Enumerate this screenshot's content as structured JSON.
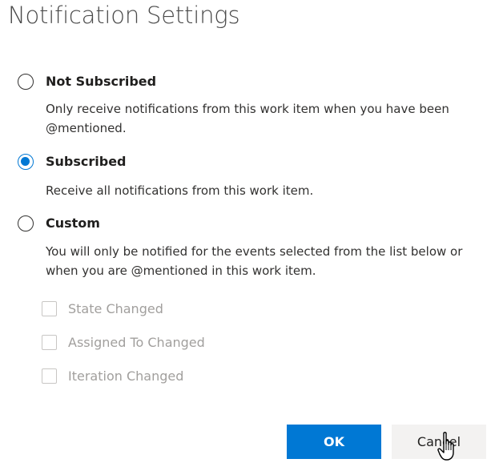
{
  "dialog": {
    "title": "Notification Settings"
  },
  "options": [
    {
      "label": "Not Subscribed",
      "description": "Only receive notifications from this work item when you have been @mentioned.",
      "selected": false
    },
    {
      "label": "Subscribed",
      "description": "Receive all notifications from this work item.",
      "selected": true
    },
    {
      "label": "Custom",
      "description": "You will only be notified for the events selected from the list below or when you are @mentioned in this work item.",
      "selected": false
    }
  ],
  "custom_events": [
    {
      "label": "State Changed",
      "checked": false,
      "disabled": true
    },
    {
      "label": "Assigned To Changed",
      "checked": false,
      "disabled": true
    },
    {
      "label": "Iteration Changed",
      "checked": false,
      "disabled": true
    }
  ],
  "buttons": {
    "ok_label": "OK",
    "cancel_label": "Cancel"
  },
  "colors": {
    "accent": "#0078d4",
    "disabled_text": "#a19f9d"
  },
  "cursor_icon": "hand-pointer-icon"
}
